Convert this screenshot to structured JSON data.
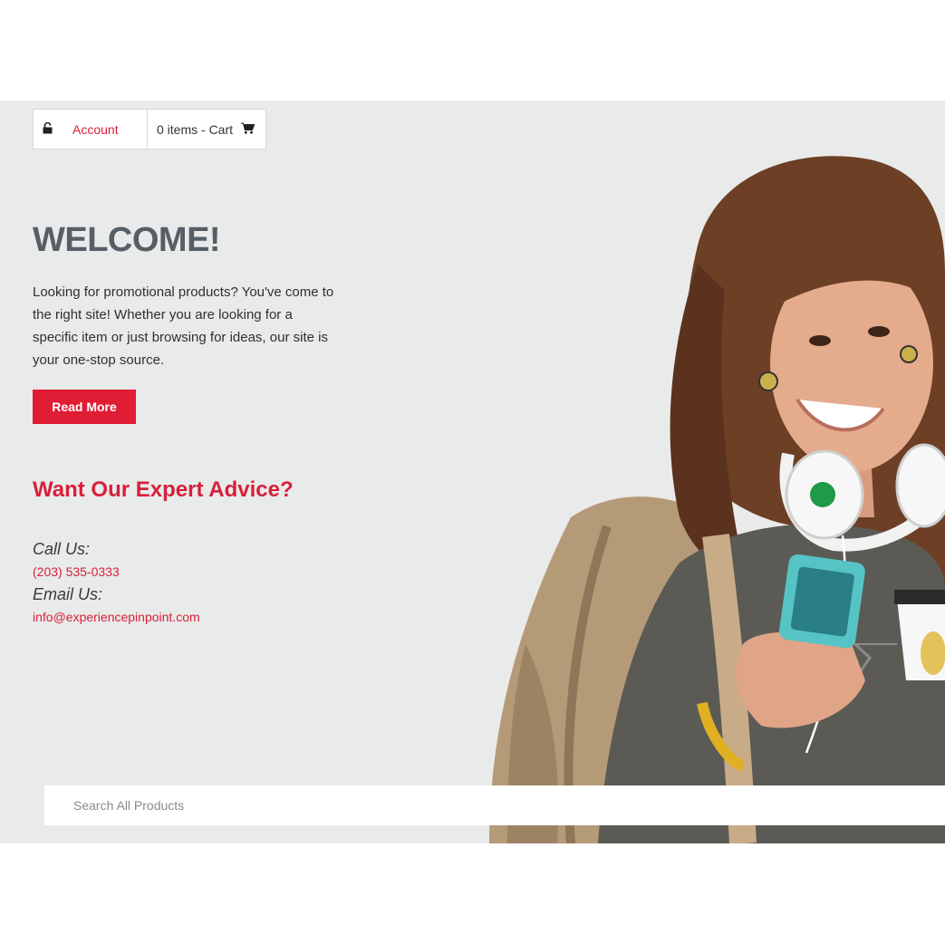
{
  "header": {
    "account_label": "Account",
    "cart_label": "0 items - Cart",
    "icons": {
      "lock": "lock-icon",
      "cart": "cart-icon"
    }
  },
  "welcome": {
    "title": "WELCOME!",
    "intro": "Looking for promotional products? You've come to the right site! Whether you are looking for a specific item or just browsing for ideas, our site is your one-stop source.",
    "read_more_label": "Read More"
  },
  "advice": {
    "title": "Want Our Expert Advice?",
    "call_label": "Call Us:",
    "phone": "(203) 535-0333",
    "email_label": "Email Us:",
    "email": "info@experiencepinpoint.com"
  },
  "search": {
    "placeholder": "Search All Products"
  },
  "colors": {
    "accent": "#e11d35",
    "hero_background": "#e9eaea",
    "heading_gray": "#575f66"
  }
}
